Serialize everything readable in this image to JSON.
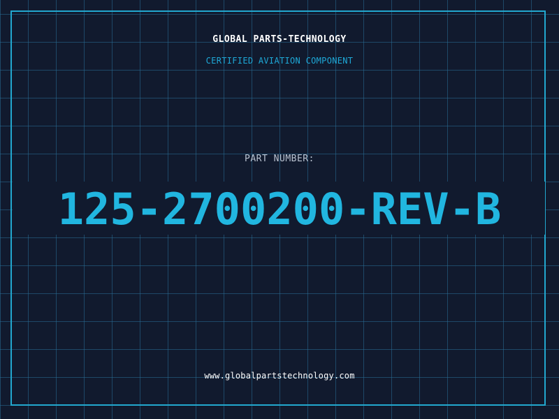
{
  "header": {
    "company_name": "GLOBAL PARTS-TECHNOLOGY",
    "tagline": "CERTIFIED AVIATION COMPONENT"
  },
  "part": {
    "label": "PART NUMBER:",
    "number": "125-2700200-REV-B"
  },
  "footer": {
    "website": "www.globalpartstechnology.com"
  },
  "colors": {
    "background": "#111a2e",
    "grid": "#286e96",
    "accent": "#22a8cf",
    "part_number": "#21b6e0",
    "label": "#b9c2d0",
    "text": "#ffffff"
  }
}
